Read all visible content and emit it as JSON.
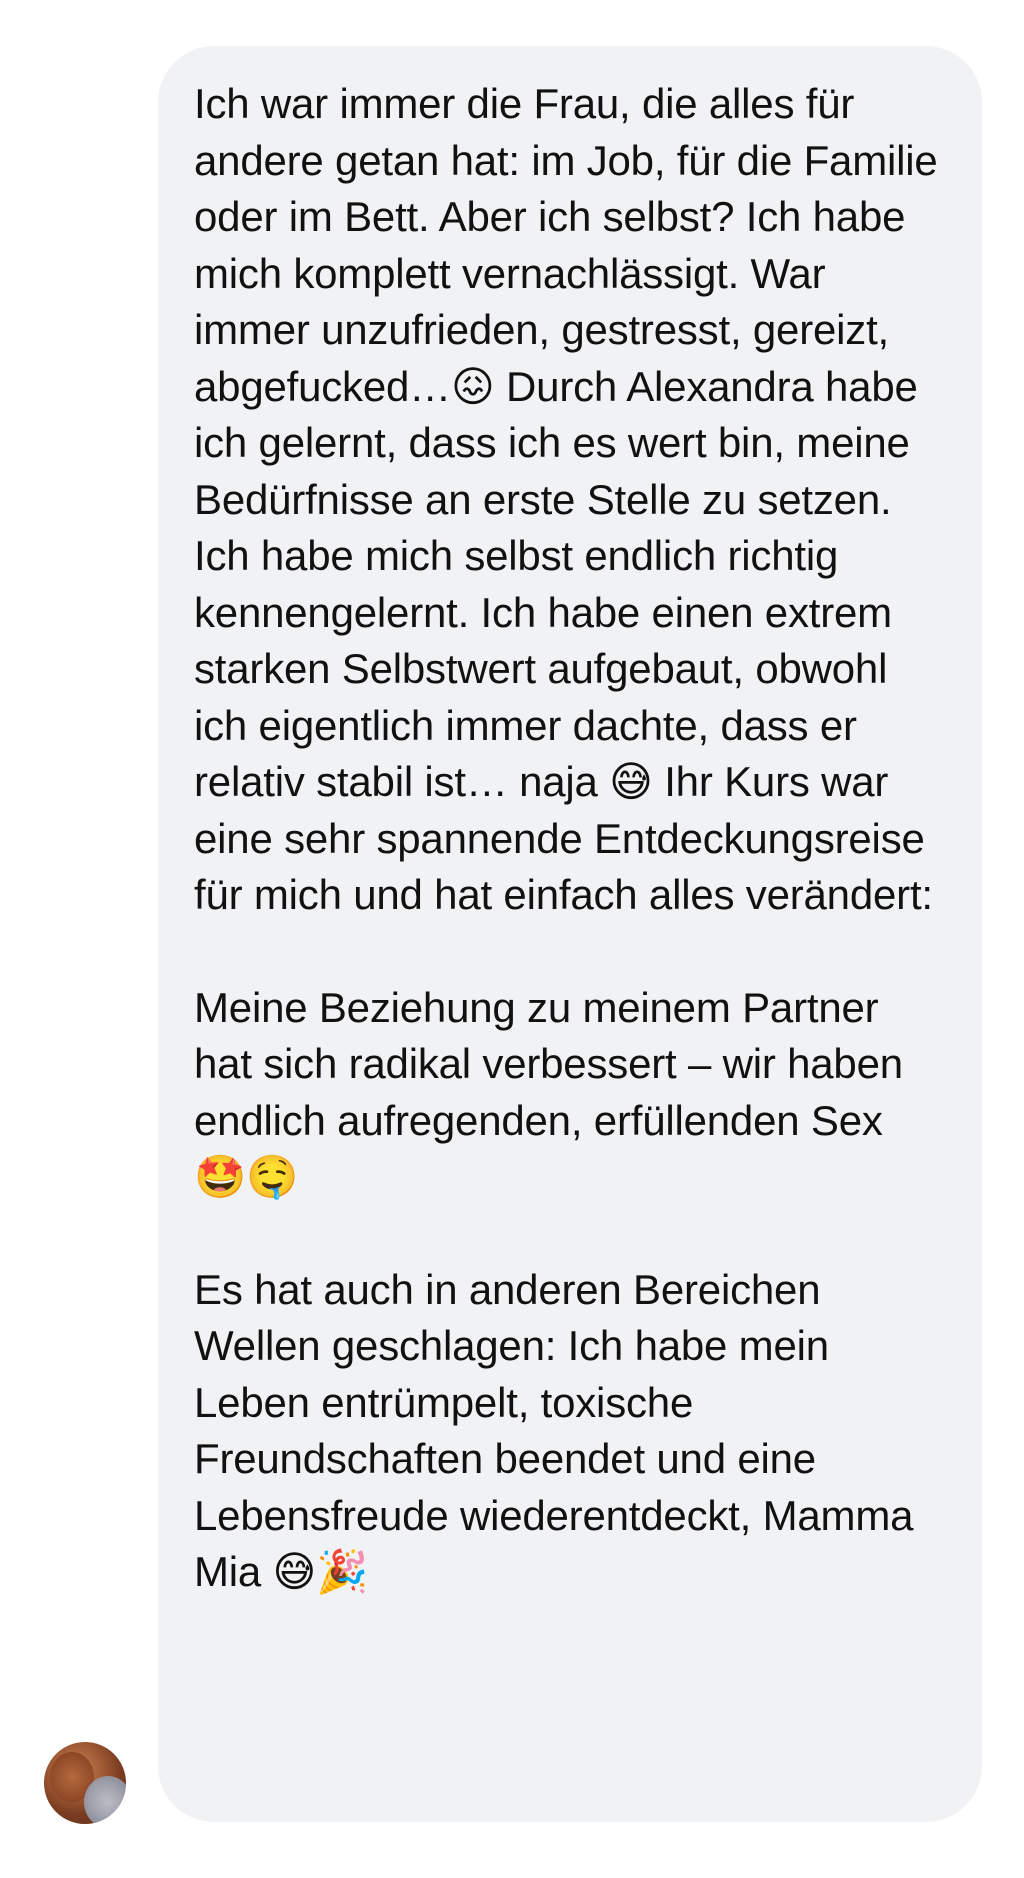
{
  "message": {
    "paragraphs": [
      "Ich war immer die Frau, die alles für andere getan hat: im Job, für die Familie oder im Bett. Aber ich selbst? Ich habe mich komplett vernachlässigt. War immer unzufrieden, gestresst, gereizt, abgefucked…😖 Durch Alexandra habe ich gelernt, dass ich es wert bin, meine Bedürfnisse an erste Stelle zu setzen. Ich habe mich selbst endlich richtig kennengelernt. Ich habe einen extrem starken Selbstwert aufgebaut, obwohl ich eigentlich immer dachte, dass er relativ stabil ist… naja 😅 Ihr Kurs war eine sehr spannende Entdeckungsreise für mich und hat einfach alles verändert:",
      "Meine Beziehung zu meinem Partner hat sich radikal verbessert – wir haben endlich aufregenden, erfüllenden Sex 🤩🤤",
      "Es hat auch in anderen Bereichen Wellen geschlagen: Ich habe mein Leben entrümpelt, toxische Freundschaften beendet und eine Lebensfreude wiederentdeckt, Mamma Mia 😅🎉"
    ]
  },
  "colors": {
    "bubble_background": "#f1f2f4",
    "text": "#111111",
    "page_background": "#ffffff"
  },
  "icons": {
    "avatar": "sender-avatar"
  }
}
